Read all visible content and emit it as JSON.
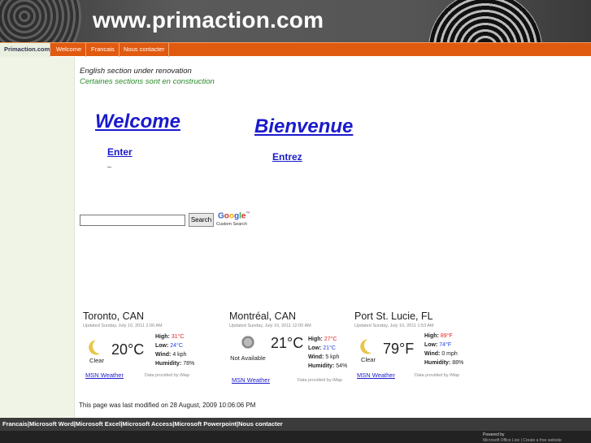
{
  "header": {
    "title": "www.primaction.com"
  },
  "nav": {
    "tabs": [
      {
        "label": "Primaction.com",
        "active": true
      },
      {
        "label": "Welcome",
        "active": false
      },
      {
        "label": "Francais",
        "active": false
      },
      {
        "label": "Nous contacter",
        "active": false
      }
    ]
  },
  "notes": {
    "english": "English section under renovation",
    "french": "Certaines sections sont en construction"
  },
  "links": {
    "welcome": "Welcome",
    "enter": "Enter",
    "bienvenue": "Bienvenue",
    "entrez": "Entrez",
    "dash": "–"
  },
  "search": {
    "button": "Search",
    "logo": [
      "G",
      "o",
      "o",
      "g",
      "l",
      "e"
    ],
    "tm": "™",
    "custom": "Custom Search"
  },
  "weather": [
    {
      "city": "Toronto, CAN",
      "updated": "Updated Sunday, July 10, 2011 2:00 AM",
      "condition": "Clear",
      "icon": "moon-icon",
      "temp": "20°C",
      "high": "31°C",
      "low": "24°C",
      "wind": "4 kph",
      "humidity": "78%",
      "msn": "MSN Weather",
      "provider": "Data provided by iMap"
    },
    {
      "city": "Montréal, CAN",
      "updated": "Updated Sunday, July 10, 2011 12:00 AM",
      "condition": "Not Available",
      "icon": "na-weather-icon",
      "temp": "21°C",
      "high": "27°C",
      "low": "21°C",
      "wind": "5 kph",
      "humidity": "54%",
      "msn": "MSN Weather",
      "provider": "Data provided by iMap"
    },
    {
      "city": "Port St. Lucie, FL",
      "updated": "Updated Sunday, July 10, 2011 1:53 AM",
      "condition": "Clear",
      "icon": "moon-icon",
      "temp": "79°F",
      "high": "89°F",
      "low": "74°F",
      "wind": "0 mph",
      "humidity": "88%",
      "msn": "MSN Weather",
      "provider": "Data provided by iMap"
    }
  ],
  "labels": {
    "high": "High:",
    "low": "Low:",
    "wind": "Wind:",
    "humidity": "Humidity:"
  },
  "modified": "This page was last modified on 28 August, 2009 10:06:06 PM",
  "footer": {
    "links": "Francais|Microsoft Word|Microsoft Excel|Microsoft Access|Microsoft Powerpoint|Nous contacter",
    "powered": "Powered by",
    "msoffice": "Microsoft Office Live | Create a free website"
  }
}
